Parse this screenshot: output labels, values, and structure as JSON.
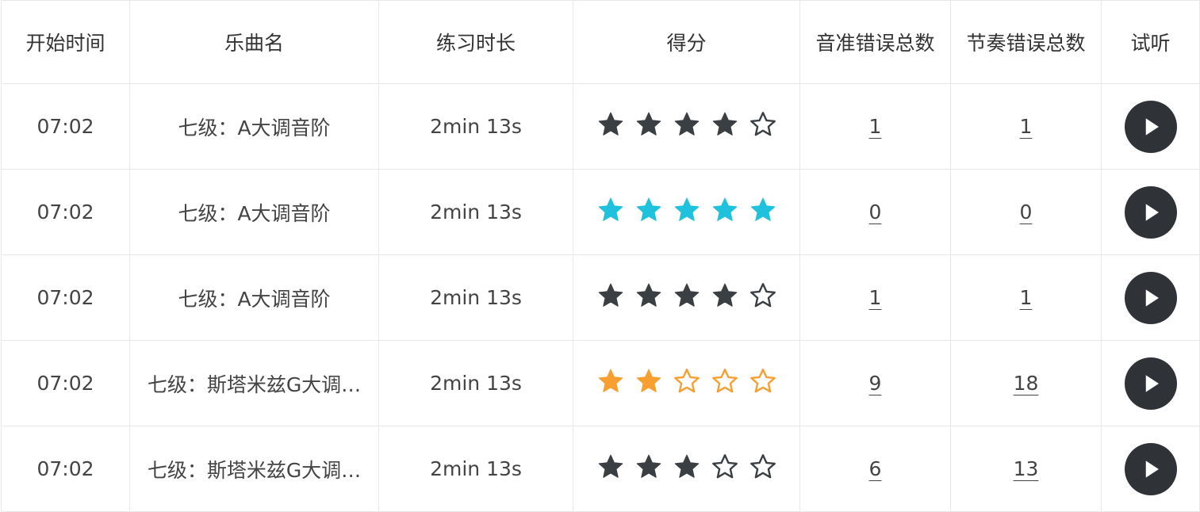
{
  "table": {
    "headers": {
      "start_time": "开始时间",
      "song": "乐曲名",
      "duration": "练习时长",
      "score": "得分",
      "pitch_errors": "音准错误总数",
      "rhythm_errors": "节奏错误总数",
      "listen": "试听"
    },
    "rows": [
      {
        "start_time": "07:02",
        "song": "七级：A大调音阶",
        "duration": "2min 13s",
        "stars": 4,
        "star_color": "#3a3f44",
        "pitch_errors": "1",
        "rhythm_errors": "1"
      },
      {
        "start_time": "07:02",
        "song": "七级：A大调音阶",
        "duration": "2min 13s",
        "stars": 5,
        "star_color": "#1fc1dc",
        "pitch_errors": "0",
        "rhythm_errors": "0"
      },
      {
        "start_time": "07:02",
        "song": "七级：A大调音阶",
        "duration": "2min 13s",
        "stars": 4,
        "star_color": "#3a3f44",
        "pitch_errors": "1",
        "rhythm_errors": "1"
      },
      {
        "start_time": "07:02",
        "song": "七级：斯塔米兹G大调…",
        "duration": "2min 13s",
        "stars": 2,
        "star_color": "#f7a031",
        "pitch_errors": "9",
        "rhythm_errors": "18"
      },
      {
        "start_time": "07:02",
        "song": "七级：斯塔米兹G大调…",
        "duration": "2min 13s",
        "stars": 3,
        "star_color": "#3a3f44",
        "pitch_errors": "6",
        "rhythm_errors": "13"
      }
    ],
    "max_stars": 5,
    "play_icon": "play-icon"
  }
}
